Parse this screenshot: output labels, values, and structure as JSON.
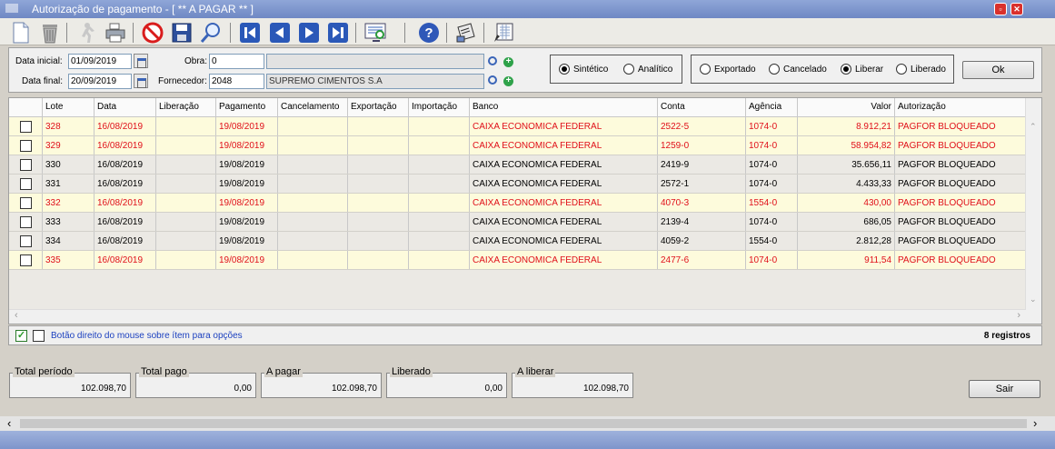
{
  "window": {
    "title": "Autorização de pagamento - [ ** A PAGAR ** ]"
  },
  "filters": {
    "data_inicial_label": "Data inicial:",
    "data_inicial": "01/09/2019",
    "data_final_label": "Data final:",
    "data_final": "20/09/2019",
    "obra_label": "Obra:",
    "obra_code": "0",
    "obra_name": "",
    "fornecedor_label": "Fornecedor:",
    "fornecedor_code": "2048",
    "fornecedor_name": "SUPREMO CIMENTOS S.A"
  },
  "view_mode": {
    "sintetico": "Sintético",
    "analitico": "Analítico",
    "selected": "sintetico"
  },
  "status_filter": {
    "exportado": "Exportado",
    "cancelado": "Cancelado",
    "liberar": "Liberar",
    "liberado": "Liberado",
    "selected": "liberar"
  },
  "ok_label": "Ok",
  "grid": {
    "columns": [
      "Lote",
      "Data",
      "Liberação",
      "Pagamento",
      "Cancelamento",
      "Exportação",
      "Importação",
      "Banco",
      "Conta",
      "Agência",
      "Valor",
      "Autorização"
    ],
    "rows": [
      {
        "lote": "328",
        "data": "16/08/2019",
        "liberacao": "",
        "pagamento": "19/08/2019",
        "cancelamento": "",
        "exportacao": "",
        "importacao": "",
        "banco": "CAIXA ECONOMICA FEDERAL",
        "conta": "2522-5",
        "agencia": "1074-0",
        "valor": "8.912,21",
        "autorizacao": "PAGFOR BLOQUEADO",
        "highlight": true
      },
      {
        "lote": "329",
        "data": "16/08/2019",
        "liberacao": "",
        "pagamento": "19/08/2019",
        "cancelamento": "",
        "exportacao": "",
        "importacao": "",
        "banco": "CAIXA ECONOMICA FEDERAL",
        "conta": "1259-0",
        "agencia": "1074-0",
        "valor": "58.954,82",
        "autorizacao": "PAGFOR BLOQUEADO",
        "highlight": true
      },
      {
        "lote": "330",
        "data": "16/08/2019",
        "liberacao": "",
        "pagamento": "19/08/2019",
        "cancelamento": "",
        "exportacao": "",
        "importacao": "",
        "banco": "CAIXA ECONOMICA FEDERAL",
        "conta": "2419-9",
        "agencia": "1074-0",
        "valor": "35.656,11",
        "autorizacao": "PAGFOR BLOQUEADO",
        "highlight": false
      },
      {
        "lote": "331",
        "data": "16/08/2019",
        "liberacao": "",
        "pagamento": "19/08/2019",
        "cancelamento": "",
        "exportacao": "",
        "importacao": "",
        "banco": "CAIXA ECONOMICA FEDERAL",
        "conta": "2572-1",
        "agencia": "1074-0",
        "valor": "4.433,33",
        "autorizacao": "PAGFOR BLOQUEADO",
        "highlight": false
      },
      {
        "lote": "332",
        "data": "16/08/2019",
        "liberacao": "",
        "pagamento": "19/08/2019",
        "cancelamento": "",
        "exportacao": "",
        "importacao": "",
        "banco": "CAIXA ECONOMICA FEDERAL",
        "conta": "4070-3",
        "agencia": "1554-0",
        "valor": "430,00",
        "autorizacao": "PAGFOR BLOQUEADO",
        "highlight": true
      },
      {
        "lote": "333",
        "data": "16/08/2019",
        "liberacao": "",
        "pagamento": "19/08/2019",
        "cancelamento": "",
        "exportacao": "",
        "importacao": "",
        "banco": "CAIXA ECONOMICA FEDERAL",
        "conta": "2139-4",
        "agencia": "1074-0",
        "valor": "686,05",
        "autorizacao": "PAGFOR BLOQUEADO",
        "highlight": false
      },
      {
        "lote": "334",
        "data": "16/08/2019",
        "liberacao": "",
        "pagamento": "19/08/2019",
        "cancelamento": "",
        "exportacao": "",
        "importacao": "",
        "banco": "CAIXA ECONOMICA FEDERAL",
        "conta": "4059-2",
        "agencia": "1554-0",
        "valor": "2.812,28",
        "autorizacao": "PAGFOR BLOQUEADO",
        "highlight": false
      },
      {
        "lote": "335",
        "data": "16/08/2019",
        "liberacao": "",
        "pagamento": "19/08/2019",
        "cancelamento": "",
        "exportacao": "",
        "importacao": "",
        "banco": "CAIXA ECONOMICA FEDERAL",
        "conta": "2477-6",
        "agencia": "1074-0",
        "valor": "911,54",
        "autorizacao": "PAGFOR BLOQUEADO",
        "highlight": true
      }
    ]
  },
  "footer": {
    "hint": "Botão direito do mouse sobre ítem para opções",
    "count": "8 registros"
  },
  "totals": [
    {
      "label": "Total período",
      "value": "102.098,70"
    },
    {
      "label": "Total pago",
      "value": "0,00"
    },
    {
      "label": "A pagar",
      "value": "102.098,70"
    },
    {
      "label": "Liberado",
      "value": "0,00"
    },
    {
      "label": "A liberar",
      "value": "102.098,70"
    }
  ],
  "sair_label": "Sair",
  "colors": {
    "highlight_text": "#e0101a",
    "highlight_bg": "#fdfbdc",
    "title_bar": "#7b93cb"
  },
  "toolbar_icons": [
    "new-document-icon",
    "trash-icon",
    "run-icon",
    "print-icon",
    "cancel-icon",
    "save-icon",
    "search-icon",
    "first-record-icon",
    "previous-record-icon",
    "next-record-icon",
    "last-record-icon",
    "preview-icon",
    "help-icon",
    "export-icon",
    "edit-sheet-icon"
  ]
}
